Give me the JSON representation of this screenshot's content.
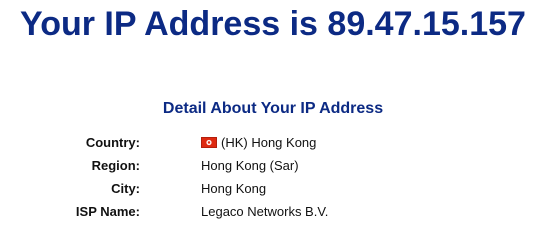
{
  "header": {
    "title": "Your IP Address is 89.47.15.157"
  },
  "details": {
    "heading": "Detail About Your IP Address",
    "rows": [
      {
        "label": "Country:",
        "value": "(HK) Hong Kong",
        "flag_icon": "hong-kong-flag-icon"
      },
      {
        "label": "Region:",
        "value": "Hong Kong (Sar)"
      },
      {
        "label": "City:",
        "value": "Hong Kong"
      },
      {
        "label": "ISP Name:",
        "value": "Legaco Networks B.V."
      }
    ]
  },
  "colors": {
    "heading": "#0c2a84",
    "text": "#111111",
    "flag_red": "#de2910"
  }
}
